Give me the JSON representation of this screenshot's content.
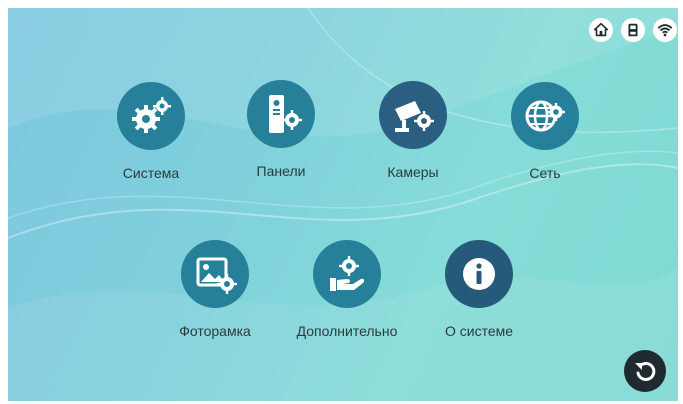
{
  "colors": {
    "circle_teal": "#26809a",
    "circle_dark": "#2a5f82",
    "circle_navy": "#255a7a",
    "icon_white": "#ffffff",
    "back_button": "#1e2a2e"
  },
  "status_bar": {
    "icons": [
      "home-icon",
      "sd-card-icon",
      "wifi-icon"
    ]
  },
  "menu": {
    "row1": [
      {
        "label": "Система",
        "icon": "gears-icon"
      },
      {
        "label": "Панели",
        "icon": "door-panel-icon"
      },
      {
        "label": "Камеры",
        "icon": "camera-gear-icon"
      },
      {
        "label": "Сеть",
        "icon": "globe-gear-icon"
      }
    ],
    "row2": [
      {
        "label": "Фоторамка",
        "icon": "photo-frame-icon"
      },
      {
        "label": "Дополнительно",
        "icon": "hand-gear-icon"
      },
      {
        "label": "О системе",
        "icon": "info-icon"
      }
    ]
  },
  "back_button": {
    "icon": "back-arrow-icon"
  }
}
